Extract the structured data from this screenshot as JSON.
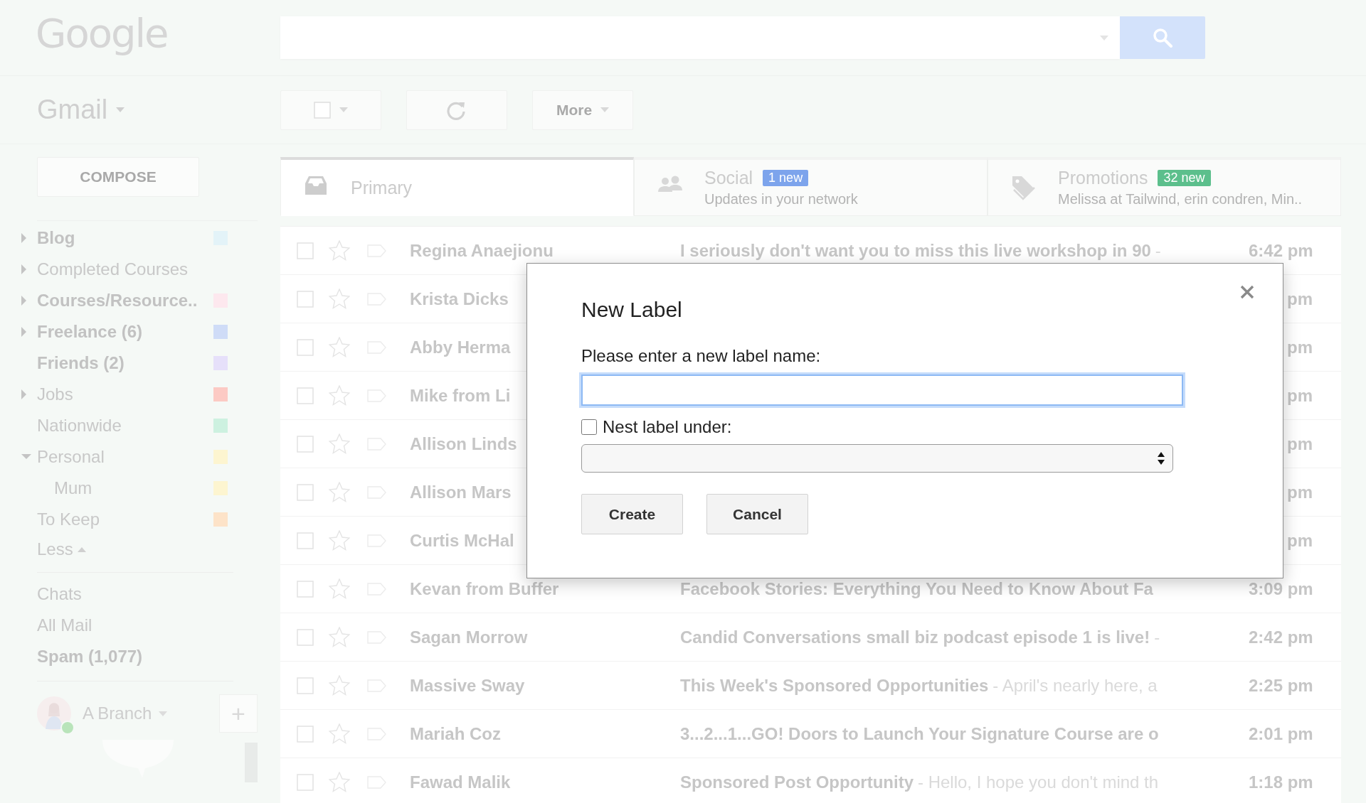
{
  "header": {
    "logo": "Google"
  },
  "toolbar": {
    "app": "Gmail",
    "more": "More"
  },
  "sidebar": {
    "compose": "COMPOSE",
    "labels": [
      {
        "kind": "parent",
        "label": "Blog",
        "unread": true,
        "expanded": false,
        "color": "#e3f3f8"
      },
      {
        "kind": "parent",
        "label": "Completed Courses",
        "unread": false,
        "expanded": false
      },
      {
        "kind": "parent",
        "label": "Courses/Resource..",
        "unread": true,
        "expanded": false,
        "color": "#fde8ee"
      },
      {
        "kind": "parent",
        "label": "Freelance (6)",
        "unread": true,
        "expanded": false,
        "color": "#cfdcf7"
      },
      {
        "kind": "leaf",
        "label": "Friends (2)",
        "unread": true,
        "color": "#e6e0fa"
      },
      {
        "kind": "parent",
        "label": "Jobs",
        "unread": false,
        "expanded": false,
        "color": "#fccac4"
      },
      {
        "kind": "leaf",
        "label": "Nationwide",
        "unread": false,
        "color": "#cdf1e0"
      },
      {
        "kind": "parent",
        "label": "Personal",
        "unread": false,
        "expanded": true,
        "color": "#fdf5d0",
        "children": [
          {
            "label": "Mum",
            "unread": false,
            "color": "#fdf5d0"
          }
        ]
      },
      {
        "kind": "leaf",
        "label": "To Keep",
        "unread": false,
        "color": "#fde3c8"
      }
    ],
    "less": "Less",
    "folders": [
      {
        "label": "Chats",
        "unread": false
      },
      {
        "label": "All Mail",
        "unread": false
      },
      {
        "label": "Spam (1,077)",
        "unread": true
      }
    ],
    "account": {
      "name": "A Branch",
      "online": true,
      "add": "+"
    }
  },
  "tabs": [
    {
      "kind": "inbox",
      "label": "Primary",
      "selected": true
    },
    {
      "kind": "people",
      "label": "Social",
      "badge": "1 new",
      "color": "#7da4ec",
      "subtitle": "Updates in your network",
      "selected": false
    },
    {
      "kind": "tag",
      "label": "Promotions",
      "badge": "32 new",
      "color": "#5cbf8c",
      "subtitle": "Melissa at Tailwind, erin condren, Min..",
      "selected": false
    }
  ],
  "emails": [
    {
      "sender": "Regina Anaejionu",
      "subject": "I seriously don't want you to miss this live workshop in 90",
      "snippet": "-",
      "time": "6:42 pm",
      "unread": true,
      "selected": false,
      "starred": false
    },
    {
      "sender": "Krista Dicks",
      "time": "pm",
      "unread": true,
      "selected": false,
      "starred": false
    },
    {
      "sender": "Abby Herma",
      "time": "pm",
      "unread": true,
      "selected": false,
      "starred": false
    },
    {
      "sender": "Mike from Li",
      "time": "pm",
      "unread": true,
      "selected": false,
      "starred": false
    },
    {
      "sender": "Allison Linds",
      "time": "pm",
      "unread": true,
      "selected": false,
      "starred": false
    },
    {
      "sender": "Allison Mars",
      "time": "pm",
      "unread": true,
      "selected": false,
      "starred": false
    },
    {
      "sender": "Curtis McHal",
      "time": "pm",
      "unread": true,
      "selected": false,
      "starred": false
    },
    {
      "sender": "Kevan from Buffer",
      "subject": "Facebook Stories: Everything You Need to Know About Fa",
      "time": "3:09 pm",
      "unread": true,
      "selected": false,
      "starred": false
    },
    {
      "sender": "Sagan Morrow",
      "subject": "Candid Conversations small biz podcast episode 1 is live!",
      "snippet": "-",
      "time": "2:42 pm",
      "unread": true,
      "selected": false,
      "starred": false
    },
    {
      "sender": "Massive Sway",
      "subject": "This Week's Sponsored Opportunities",
      "snippet": "- April's nearly here, a",
      "time": "2:25 pm",
      "unread": true,
      "selected": false,
      "starred": false
    },
    {
      "sender": "Mariah Coz",
      "subject": "3...2...1...GO! Doors to Launch Your Signature Course are o",
      "time": "2:01 pm",
      "unread": true,
      "selected": false,
      "starred": false
    },
    {
      "sender": "Fawad Malik",
      "subject": "Sponsored Post Opportunity",
      "snippet": "- Hello, I hope you don't mind th",
      "time": "1:18 pm",
      "unread": true,
      "selected": false,
      "starred": false
    }
  ],
  "dialog": {
    "title": "New Label",
    "prompt": "Please enter a new label name:",
    "input": {
      "focused": true
    },
    "nest": {
      "label": "Nest label under:",
      "checked": false
    },
    "buttons": [
      "Create",
      "Cancel"
    ]
  }
}
